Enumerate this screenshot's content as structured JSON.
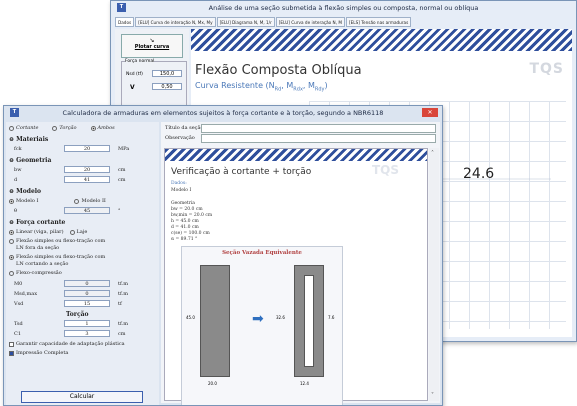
{
  "back_window": {
    "title": "Análise de uma seção submetida à flexão simples ou composta, normal ou oblíqua",
    "tabs": [
      "Dados",
      "[ELU] Curva de interação N, Mx, My",
      "[ELU] Diagrama N, M, 1/r",
      "[ELU] Curva de interação N, M",
      "[ELS] Tensão nas armaduras"
    ],
    "draw_button": "Plotar curva",
    "force_label": "Força normal",
    "nsd_label": "Nsd (tf)",
    "nsd_value": "150,0",
    "v_label": "V",
    "v_value": "0,50",
    "heading": "Flexão Composta Oblíqua",
    "subheading": "Curva Resistente (N",
    "subheading_sub": "Rd",
    "subheading_rest1": ", M",
    "subheading_sub2": "Rdx",
    "subheading_rest2": ", M",
    "subheading_sub3": "Rdy",
    "subheading_end": ")",
    "logo": "TQS",
    "value": "24.6"
  },
  "front_window": {
    "title": "Calculadora de armaduras em elementos sujeitos à força cortante e à torção, segundo a NBR6118",
    "mode_options": [
      "Cortante",
      "Torção",
      "Ambos"
    ],
    "selected_mode": "Ambos",
    "materials": {
      "label": "Materiais",
      "fck": "fck",
      "fck_value": "20",
      "fck_unit": "MPa"
    },
    "geometry": {
      "label": "Geometria",
      "bw": "bw",
      "bw_value": "20",
      "bw_unit": "cm",
      "d": "d",
      "d_value": "41",
      "d_unit": "cm"
    },
    "model": {
      "label": "Modelo",
      "option1": "Modelo I",
      "option2": "Modelo II",
      "theta": "θ",
      "theta_value": "45",
      "theta_unit": "°"
    },
    "shear": {
      "label": "Força cortante",
      "opt1": "Linear (viga, pilar)",
      "opt1b": "Laje",
      "opt2a": "Flexão simples ou flexo-tração com",
      "opt2b": "LN fora da seção",
      "opt3a": "Flexão simples ou flexo-tração com",
      "opt3b": "LN cortando a seção",
      "opt4": "Flexo-compressão",
      "ms_label": "M0",
      "ms_value": "0",
      "ms_unit": "tf.m",
      "msd_label": "Msd,max",
      "msd_value": "0",
      "msd_unit": "tf.m",
      "vsd_label": "Vsd",
      "vsd_value": "15",
      "vsd_unit": "tf"
    },
    "torsion": {
      "label": "Torção",
      "tsd_label": "Tsd",
      "tsd_value": "1",
      "tsd_unit": "tf.m",
      "c1_label": "C1",
      "c1_value": "3",
      "c1_unit": "cm"
    },
    "check1": "Garantir capacidade de adaptação plástica",
    "check2": "Impressão Completa",
    "calc_button": "Calcular",
    "section_title_label": "Título da seção",
    "observation_label": "Observação",
    "report_title": "Verificação à cortante + torção",
    "report_data_label": "Dados:",
    "report_model": "Modelo I",
    "report_geometry_label": "Geometria",
    "report_lines": [
      "bw = 20.0 cm",
      "bw,min = 20.0 cm",
      "h = 45.0 cm",
      "d = 41.0 cm",
      "c(se) = 100.0 cm",
      "α = 89.71 °"
    ],
    "diagram_title": "Seção Vazada Equivalente",
    "dim_left": "45.0",
    "dim_bottom": "20.0",
    "dim_inner": "32.6",
    "dim_inner_side": "7.6",
    "dim_right": "12.4",
    "report_logo": "TQS"
  },
  "colors": {
    "hatch": "#2f4f9c",
    "accent": "#4a78b8",
    "curve": "#e88a8a",
    "close": "#d9463a"
  }
}
